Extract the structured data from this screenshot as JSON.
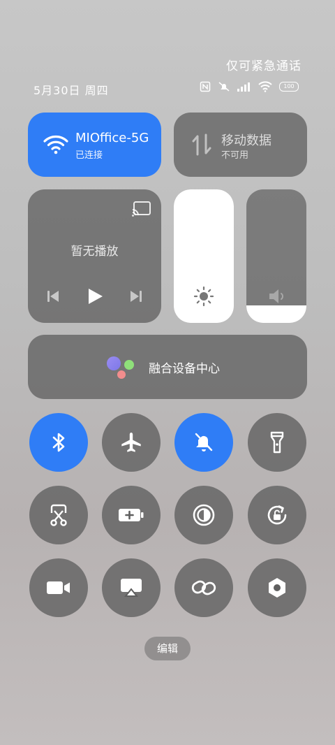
{
  "status_bar": {
    "emergency_text": "仅可紧急通话",
    "date_text": "5月30日 周四",
    "battery": "100"
  },
  "wifi_tile": {
    "title": "MIOffice-5G",
    "subtitle": "已连接",
    "active": true
  },
  "mobile_data_tile": {
    "title": "移动数据",
    "subtitle": "不可用",
    "active": false
  },
  "media": {
    "status_text": "暂无播放"
  },
  "brightness": {
    "level": 1.0
  },
  "volume": {
    "level": 0.13
  },
  "device_center": {
    "label": "融合设备中心"
  },
  "toggles": [
    {
      "id": "bluetooth",
      "icon": "bluetooth-icon",
      "active": true
    },
    {
      "id": "airplane",
      "icon": "airplane-icon",
      "active": false
    },
    {
      "id": "mute",
      "icon": "bell-off-icon",
      "active": true
    },
    {
      "id": "flashlight",
      "icon": "flashlight-icon",
      "active": false
    },
    {
      "id": "screenshot",
      "icon": "scissors-icon",
      "active": false
    },
    {
      "id": "battery-saver",
      "icon": "battery-plus-icon",
      "active": false
    },
    {
      "id": "dark-mode",
      "icon": "contrast-icon",
      "active": false
    },
    {
      "id": "rotation-lock",
      "icon": "rotate-lock-icon",
      "active": false
    },
    {
      "id": "screen-record",
      "icon": "video-camera-icon",
      "active": false
    },
    {
      "id": "cast",
      "icon": "screen-cast-icon",
      "active": false
    },
    {
      "id": "link",
      "icon": "link-icon",
      "active": false
    },
    {
      "id": "settings",
      "icon": "settings-nut-icon",
      "active": false
    }
  ],
  "edit_label": "编辑",
  "colors": {
    "accent": "#2f7df6",
    "tile": "#5a5a5a"
  }
}
